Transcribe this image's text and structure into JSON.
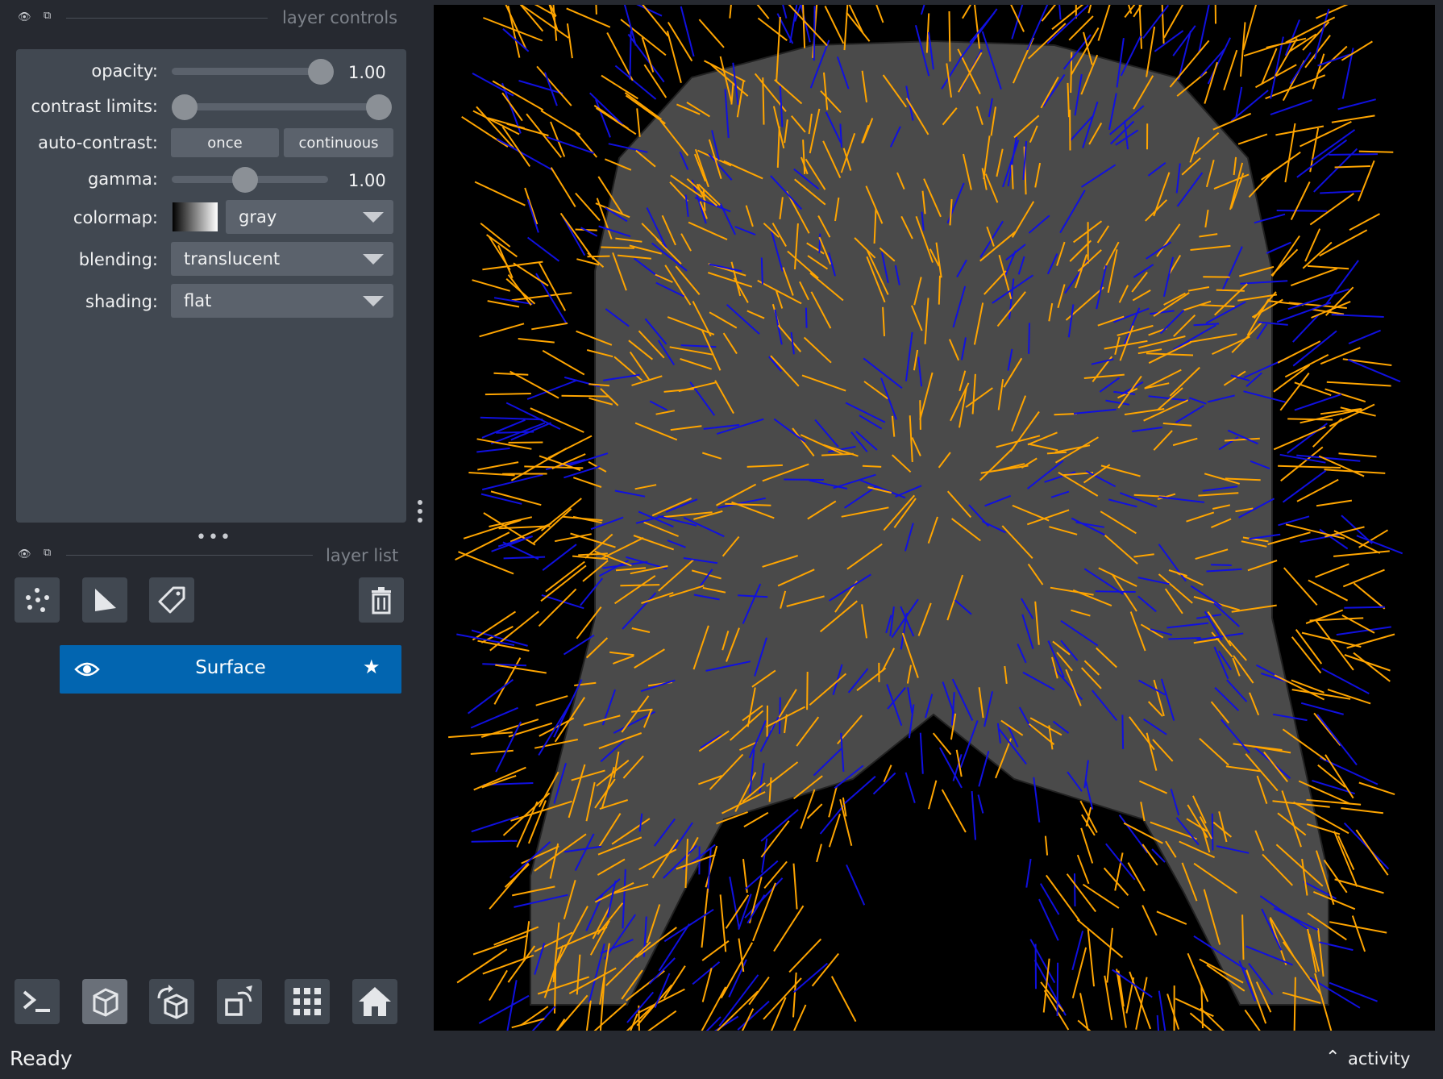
{
  "layer_controls": {
    "header": "layer controls",
    "opacity": {
      "label": "opacity:",
      "value": "1.00",
      "level": 1.0
    },
    "contrast_limits": {
      "label": "contrast limits:",
      "low": 0.0,
      "high": 1.0
    },
    "auto_contrast": {
      "label": "auto-contrast:",
      "once": "once",
      "continuous": "continuous"
    },
    "gamma": {
      "label": "gamma:",
      "value": "1.00",
      "level": 0.45
    },
    "colormap": {
      "label": "colormap:",
      "value": "gray"
    },
    "blending": {
      "label": "blending:",
      "value": "translucent"
    },
    "shading": {
      "label": "shading:",
      "value": "flat"
    }
  },
  "layer_list": {
    "header": "layer list",
    "layers": [
      {
        "name": "Surface",
        "selected": true,
        "visible": true
      }
    ]
  },
  "status": {
    "text": "Ready",
    "activity": "activity"
  },
  "colors": {
    "background": "#262930",
    "panel": "#414851",
    "control": "#5b626c",
    "selected_layer": "#0265b0",
    "normals_orange": "#ffa500",
    "normals_blue": "#1010e0",
    "surface": "#4a4a4a"
  },
  "icons": {
    "bottom_toolbar": [
      "console-icon",
      "ndisplay-3d-icon",
      "roll-dims-icon",
      "transpose-icon",
      "grid-icon",
      "home-icon"
    ],
    "layer_tools": [
      "new-points-icon",
      "new-shapes-icon",
      "new-labels-icon",
      "delete-layer-icon"
    ]
  }
}
